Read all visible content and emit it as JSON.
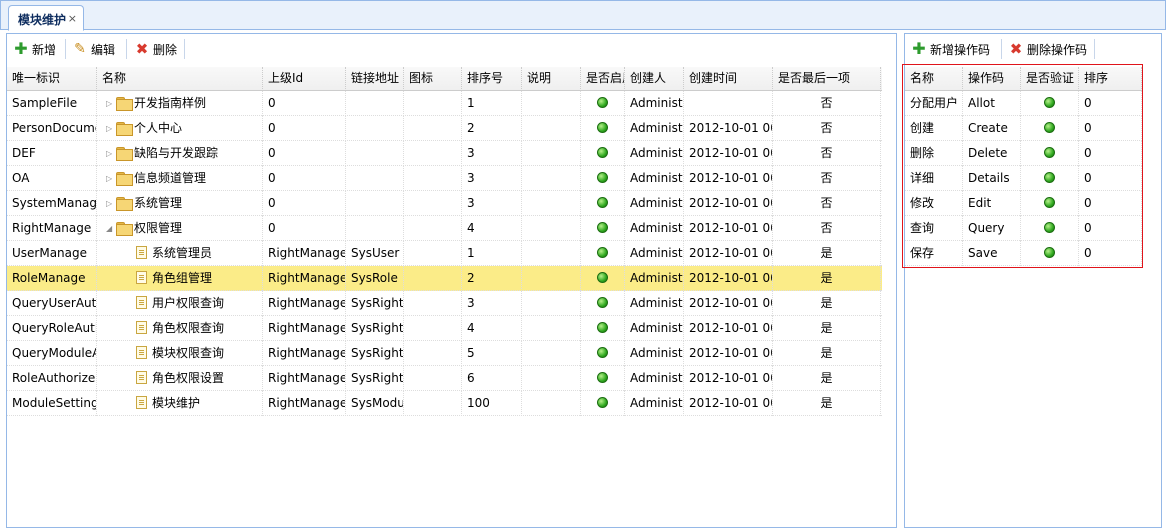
{
  "tab": {
    "title": "模块维护",
    "close": "×"
  },
  "toolbar": {
    "add": "新增",
    "edit": "编辑",
    "delete": "删除"
  },
  "right_toolbar": {
    "add_opcode": "新增操作码",
    "delete_opcode": "删除操作码"
  },
  "module_grid": {
    "columns": [
      "唯一标识",
      "名称",
      "上级Id",
      "链接地址",
      "图标",
      "排序号",
      "说明",
      "是否启用",
      "创建人",
      "创建时间",
      "是否最后一项"
    ],
    "rows": [
      {
        "id": "SampleFile",
        "name": "开发指南样例",
        "parent": "0",
        "url": "",
        "icon": "",
        "sort": "1",
        "desc": "",
        "enabled": true,
        "creator": "Administrator",
        "created": "",
        "last": "否",
        "node": "folder",
        "level": 0,
        "toggle": "▷"
      },
      {
        "id": "PersonDocument",
        "name": "个人中心",
        "parent": "0",
        "url": "",
        "icon": "",
        "sort": "2",
        "desc": "",
        "enabled": true,
        "creator": "Administrator",
        "created": "2012-10-01 00",
        "last": "否",
        "node": "folder",
        "level": 0,
        "toggle": "▷"
      },
      {
        "id": "DEF",
        "name": "缺陷与开发跟踪",
        "parent": "0",
        "url": "",
        "icon": "",
        "sort": "3",
        "desc": "",
        "enabled": true,
        "creator": "Administrator",
        "created": "2012-10-01 00",
        "last": "否",
        "node": "folder",
        "level": 0,
        "toggle": "▷"
      },
      {
        "id": "OA",
        "name": "信息频道管理",
        "parent": "0",
        "url": "",
        "icon": "",
        "sort": "3",
        "desc": "",
        "enabled": true,
        "creator": "Administrator",
        "created": "2012-10-01 00",
        "last": "否",
        "node": "folder",
        "level": 0,
        "toggle": "▷"
      },
      {
        "id": "SystemManage",
        "name": "系统管理",
        "parent": "0",
        "url": "",
        "icon": "",
        "sort": "3",
        "desc": "",
        "enabled": true,
        "creator": "Administrator",
        "created": "2012-10-01 00",
        "last": "否",
        "node": "folder",
        "level": 0,
        "toggle": "▷"
      },
      {
        "id": "RightManage",
        "name": "权限管理",
        "parent": "0",
        "url": "",
        "icon": "",
        "sort": "4",
        "desc": "",
        "enabled": true,
        "creator": "Administrator",
        "created": "2012-10-01 00",
        "last": "否",
        "node": "folder-open",
        "level": 0,
        "toggle": "◢"
      },
      {
        "id": "UserManage",
        "name": "系统管理员",
        "parent": "RightManage",
        "url": "SysUser",
        "icon": "",
        "sort": "1",
        "desc": "",
        "enabled": true,
        "creator": "Administrator",
        "created": "2012-10-01 00",
        "last": "是",
        "node": "file",
        "level": 1,
        "toggle": ""
      },
      {
        "id": "RoleManage",
        "name": "角色组管理",
        "parent": "RightManage",
        "url": "SysRole",
        "icon": "",
        "sort": "2",
        "desc": "",
        "enabled": true,
        "creator": "Administrator",
        "created": "2012-10-01 00",
        "last": "是",
        "node": "file",
        "level": 1,
        "toggle": "",
        "selected": true
      },
      {
        "id": "QueryUserAuthorize",
        "name": "用户权限查询",
        "parent": "RightManage",
        "url": "SysRightOperate",
        "icon": "",
        "sort": "3",
        "desc": "",
        "enabled": true,
        "creator": "Administrator",
        "created": "2012-10-01 00",
        "last": "是",
        "node": "file",
        "level": 1,
        "toggle": ""
      },
      {
        "id": "QueryRoleAuthorize",
        "name": "角色权限查询",
        "parent": "RightManage",
        "url": "SysRightOperate",
        "icon": "",
        "sort": "4",
        "desc": "",
        "enabled": true,
        "creator": "Administrator",
        "created": "2012-10-01 00",
        "last": "是",
        "node": "file",
        "level": 1,
        "toggle": ""
      },
      {
        "id": "QueryModuleAuthorize",
        "name": "模块权限查询",
        "parent": "RightManage",
        "url": "SysRightOperate",
        "icon": "",
        "sort": "5",
        "desc": "",
        "enabled": true,
        "creator": "Administrator",
        "created": "2012-10-01 00",
        "last": "是",
        "node": "file",
        "level": 1,
        "toggle": ""
      },
      {
        "id": "RoleAuthorize",
        "name": "角色权限设置",
        "parent": "RightManage",
        "url": "SysRight",
        "icon": "",
        "sort": "6",
        "desc": "",
        "enabled": true,
        "creator": "Administrator",
        "created": "2012-10-01 00",
        "last": "是",
        "node": "file",
        "level": 1,
        "toggle": ""
      },
      {
        "id": "ModuleSetting",
        "name": "模块维护",
        "parent": "RightManage",
        "url": "SysModule",
        "icon": "",
        "sort": "100",
        "desc": "",
        "enabled": true,
        "creator": "Administrator",
        "created": "2012-10-01 00",
        "last": "是",
        "node": "file",
        "level": 1,
        "toggle": ""
      }
    ]
  },
  "opcode_grid": {
    "columns": [
      "名称",
      "操作码",
      "是否验证",
      "排序"
    ],
    "rows": [
      {
        "name": "分配用户",
        "code": "Allot",
        "verify": true,
        "sort": "0"
      },
      {
        "name": "创建",
        "code": "Create",
        "verify": true,
        "sort": "0"
      },
      {
        "name": "删除",
        "code": "Delete",
        "verify": true,
        "sort": "0"
      },
      {
        "name": "详细",
        "code": "Details",
        "verify": true,
        "sort": "0"
      },
      {
        "name": "修改",
        "code": "Edit",
        "verify": true,
        "sort": "0"
      },
      {
        "name": "查询",
        "code": "Query",
        "verify": true,
        "sort": "0"
      },
      {
        "name": "保存",
        "code": "Save",
        "verify": true,
        "sort": "0"
      }
    ]
  },
  "colors": {
    "selected_row": "#fbec88",
    "highlight_box": "#e0141b",
    "panel_border": "#95b8e7"
  }
}
